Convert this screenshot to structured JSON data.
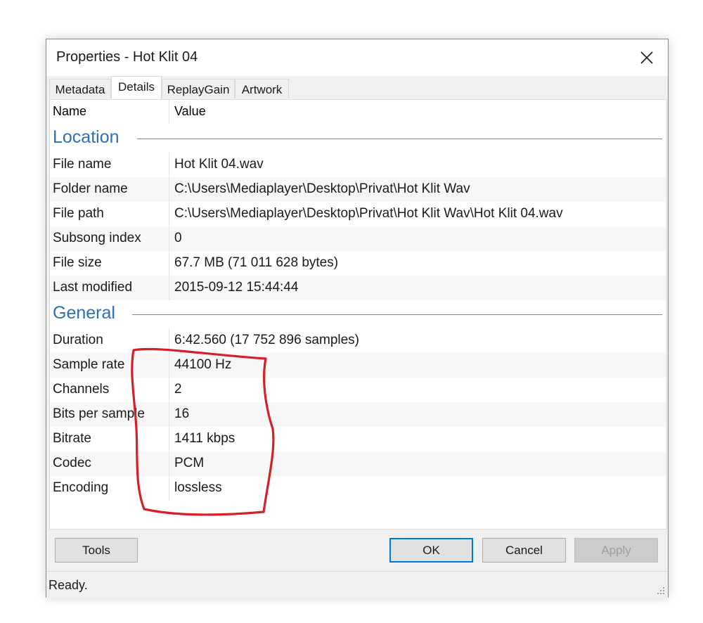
{
  "window": {
    "title": "Properties - Hot Klit 04"
  },
  "tabs": [
    {
      "label": "Metadata",
      "active": false
    },
    {
      "label": "Details",
      "active": true
    },
    {
      "label": "ReplayGain",
      "active": false
    },
    {
      "label": "Artwork",
      "active": false
    }
  ],
  "columns": {
    "name": "Name",
    "value": "Value"
  },
  "groups": {
    "location": {
      "title": "Location",
      "rows": [
        {
          "name": "File name",
          "value": "Hot Klit 04.wav"
        },
        {
          "name": "Folder name",
          "value": "C:\\Users\\Mediaplayer\\Desktop\\Privat\\Hot Klit Wav"
        },
        {
          "name": "File path",
          "value": "C:\\Users\\Mediaplayer\\Desktop\\Privat\\Hot Klit Wav\\Hot Klit 04.wav"
        },
        {
          "name": "Subsong index",
          "value": "0"
        },
        {
          "name": "File size",
          "value": "67.7 MB (71 011 628 bytes)"
        },
        {
          "name": "Last modified",
          "value": "2015-09-12 15:44:44"
        }
      ]
    },
    "general": {
      "title": "General",
      "rows": [
        {
          "name": "Duration",
          "value": "6:42.560 (17 752 896 samples)"
        },
        {
          "name": "Sample rate",
          "value": "44100 Hz"
        },
        {
          "name": "Channels",
          "value": "2"
        },
        {
          "name": "Bits per sample",
          "value": "16"
        },
        {
          "name": "Bitrate",
          "value": "1411 kbps"
        },
        {
          "name": "Codec",
          "value": "PCM"
        },
        {
          "name": "Encoding",
          "value": "lossless"
        }
      ]
    }
  },
  "buttons": {
    "tools": "Tools",
    "ok": "OK",
    "cancel": "Cancel",
    "apply": "Apply"
  },
  "status": "Ready.",
  "colors": {
    "accent": "#0078d7",
    "group_title": "#2f6fb4",
    "annotation": "#d61f26"
  },
  "icons": {
    "close": "close-icon",
    "grip": "resize-grip-icon"
  }
}
